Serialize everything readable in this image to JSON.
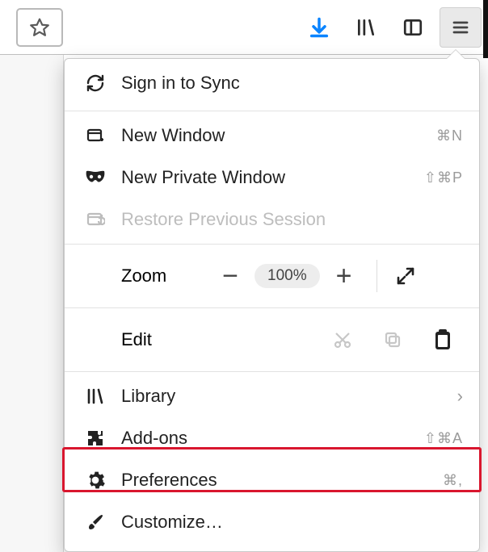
{
  "toolbar": {
    "bookmark_tooltip": "Bookmark this page",
    "downloads_tooltip": "Downloads",
    "library_tooltip": "Library",
    "sidebar_tooltip": "Sidebar",
    "menu_tooltip": "Open menu"
  },
  "menu": {
    "sync": "Sign in to Sync",
    "new_window": {
      "label": "New Window",
      "shortcut": "⌘N"
    },
    "new_private": {
      "label": "New Private Window",
      "shortcut": "⇧⌘P"
    },
    "restore": {
      "label": "Restore Previous Session"
    },
    "zoom": {
      "label": "Zoom",
      "value": "100%"
    },
    "edit": {
      "label": "Edit"
    },
    "library": {
      "label": "Library"
    },
    "addons": {
      "label": "Add-ons",
      "shortcut": "⇧⌘A"
    },
    "preferences": {
      "label": "Preferences",
      "shortcut": "⌘,"
    },
    "customize": {
      "label": "Customize…"
    }
  }
}
